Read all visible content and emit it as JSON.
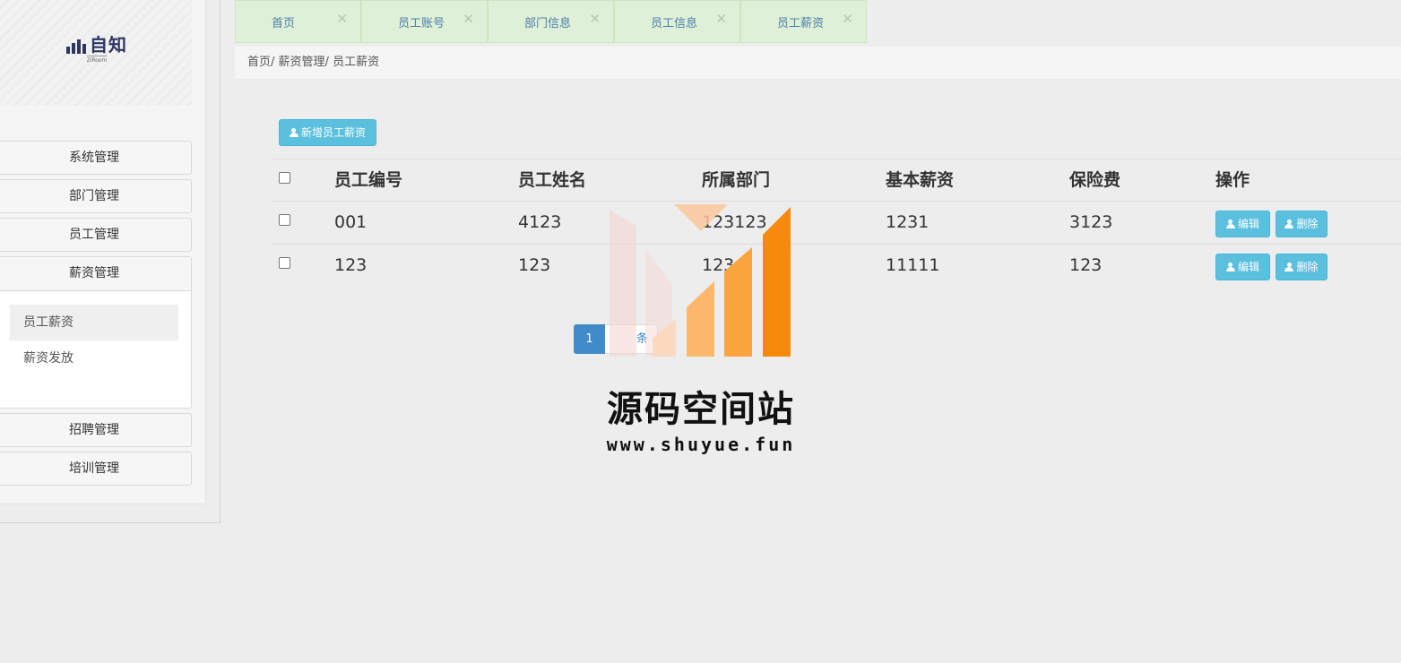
{
  "logo": {
    "text": "自知",
    "sub": "ZiRoom"
  },
  "sidebar": {
    "items": [
      {
        "label": "系统管理"
      },
      {
        "label": "部门管理"
      },
      {
        "label": "员工管理"
      },
      {
        "label": "薪资管理"
      },
      {
        "label": "招聘管理"
      },
      {
        "label": "培训管理"
      }
    ],
    "sub_items": [
      {
        "label": "员工薪资",
        "active": true
      },
      {
        "label": "薪资发放",
        "active": false
      }
    ]
  },
  "tabs": [
    {
      "label": "首页"
    },
    {
      "label": "员工账号"
    },
    {
      "label": "部门信息"
    },
    {
      "label": "员工信息"
    },
    {
      "label": "员工薪资"
    }
  ],
  "tab_close_glyph": "✕",
  "breadcrumb": [
    "首页/",
    "薪资管理/",
    "员工薪资"
  ],
  "toolbar": {
    "add_label": "新增员工薪资"
  },
  "table": {
    "headers": [
      "员工编号",
      "员工姓名",
      "所属部门",
      "基本薪资",
      "保险费",
      "操作"
    ],
    "rows": [
      [
        "001",
        "4123",
        "123123",
        "1231",
        "3123"
      ],
      [
        "123",
        "123",
        "123",
        "11111",
        "123"
      ]
    ],
    "edit_label": "编辑",
    "delete_label": "删除"
  },
  "pagination": {
    "current": "1",
    "info": "条"
  },
  "watermark": {
    "title": "源码空间站",
    "url": "www.shuyue.fun"
  },
  "colors": {
    "accent": "#5bc0de",
    "page_active": "#428bca",
    "tab_bg": "#def0d8",
    "wm_orange": "#f7890c"
  }
}
